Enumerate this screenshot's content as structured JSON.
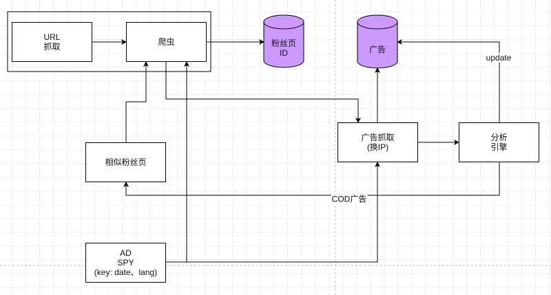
{
  "nodes": {
    "url_fetch": "URL\n抓取",
    "crawler": "爬虫",
    "fan_page_id": "粉丝页\nID",
    "ads_db": "广告",
    "ad_fetch": "广告抓取\n(换IP)",
    "analysis_engine": "分析\n引擎",
    "similar_fan_pages": "相似粉丝页",
    "ad_spy": "AD\nSPY\n(key: date、lang)"
  },
  "edge_labels": {
    "update": "update",
    "cod_ads": "COD广告"
  },
  "colors": {
    "database_fill": "#cc99ff",
    "stroke": "#000000"
  }
}
